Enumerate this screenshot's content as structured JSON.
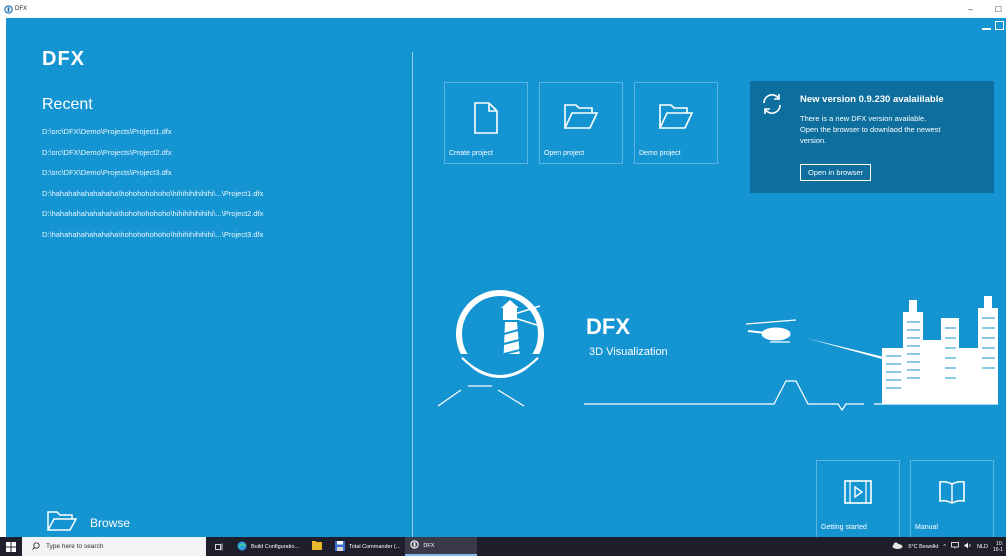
{
  "window": {
    "title": "DFX"
  },
  "app": {
    "brand": "DFX",
    "recent_title": "Recent",
    "recent": [
      "D:\\src\\DFX\\Demo\\Projects\\Project1.dfx",
      "D:\\src\\DFX\\Demo\\Projects\\Project2.dfx",
      "D:\\src\\DFX\\Demo\\Projects\\Project3.dfx",
      "D:\\hahahahahahahaha\\hohohohohoho\\hihihihihihihi\\...\\Project1.dfx",
      "D:\\hahahahahahahaha\\hohohohohoho\\hihihihihihihi\\...\\Project2.dfx",
      "D:\\hahahahahahahaha\\hohohohohoho\\hihihihihihihi\\...\\Project3.dfx"
    ],
    "browse_label": "Browse",
    "tiles": {
      "create": "Create project",
      "open": "Open project",
      "demo": "Demo project"
    },
    "update": {
      "title": "New version 0.9.230 avalaiilable",
      "line1": "There is a new DFX version available.",
      "line2": "Open the browser to downlaod the newest",
      "line3": "version.",
      "button": "Open in browser"
    },
    "logo": {
      "title": "DFX",
      "subtitle": "3D Visualization"
    },
    "help": {
      "getting_started": "Getting started",
      "manual": "Manual"
    },
    "colors": {
      "background": "#1594d2",
      "panel": "#0e6f9e",
      "text": "#ffffff"
    }
  },
  "taskbar": {
    "search_placeholder": "Type here to search",
    "apps": [
      "Build Configuratio...",
      "Total Commander (...",
      "DFX"
    ],
    "weather": "5°C  Bewolkt",
    "language": "NLD",
    "time": "10:",
    "date": "16-1"
  }
}
